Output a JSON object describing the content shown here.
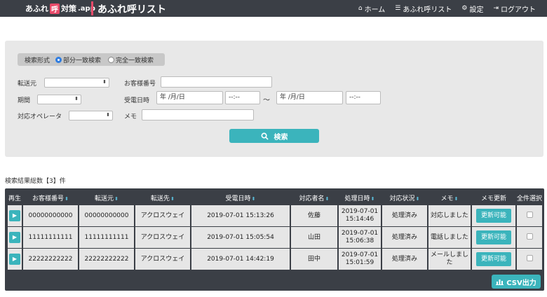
{
  "header": {
    "logo_text": "あふれ",
    "logo_mark": "呼",
    "logo_text2": "対策",
    "logo_suffix": ".app",
    "title": "あふれ呼リスト",
    "nav": [
      {
        "label": "ホーム",
        "icon": "home-icon",
        "glyph": "⌂"
      },
      {
        "label": "あふれ呼リスト",
        "icon": "list-icon",
        "glyph": "☰"
      },
      {
        "label": "設定",
        "icon": "gear-icon",
        "glyph": "⚙"
      },
      {
        "label": "ログアウト",
        "icon": "logout-icon",
        "glyph": "⇥"
      }
    ]
  },
  "search": {
    "mode_label": "検索形式",
    "mode_partial": "部分一致検索",
    "mode_exact": "完全一致検索",
    "mode_selected": "partial",
    "transfer_from_label": "転送元",
    "customer_no_label": "お客様番号",
    "period_label": "期間",
    "received_label": "受電日時",
    "date_placeholder": "年 /月/日",
    "time_placeholder": "--:--",
    "tilde": "～",
    "operator_label": "対応オペレータ",
    "memo_label": "メモ",
    "search_button": "検索",
    "caret": "⬍"
  },
  "results": {
    "count_text": "検索結果総数【3】件",
    "columns": [
      "再生",
      "お客様番号",
      "転送元",
      "転送先",
      "受電日時",
      "対応者名",
      "処理日時",
      "対応状況",
      "メモ",
      "メモ更新",
      "全件選択"
    ],
    "sortable": [
      false,
      true,
      true,
      true,
      true,
      true,
      true,
      true,
      true,
      false,
      false
    ],
    "rows": [
      {
        "customer_no": "00000000000",
        "from": "00000000000",
        "to": "アクロスウェイ",
        "received": "2019-07-01 15:13:26",
        "handler": "佐藤",
        "processed_date": "2019-07-01",
        "processed_time": "15:14:46",
        "status": "処理済み",
        "memo": "対応しました",
        "update_label": "更新可能"
      },
      {
        "customer_no": "11111111111",
        "from": "11111111111",
        "to": "アクロスウェイ",
        "received": "2019-07-01 15:05:54",
        "handler": "山田",
        "processed_date": "2019-07-01",
        "processed_time": "15:06:38",
        "status": "処理済み",
        "memo": "電話しました",
        "update_label": "更新可能"
      },
      {
        "customer_no": "22222222222",
        "from": "22222222222",
        "to": "アクロスウェイ",
        "received": "2019-07-01 14:42:19",
        "handler": "田中",
        "processed_date": "2019-07-01",
        "processed_time": "15:01:59",
        "status": "処理済み",
        "memo": "メールしました",
        "update_label": "更新可能"
      }
    ],
    "csv_button": "CSV出力"
  },
  "colors": {
    "topbar": "#3b3f46",
    "accent": "#3bb4bc",
    "brand": "#e84a6a",
    "radio_on": "#2f7de1"
  }
}
